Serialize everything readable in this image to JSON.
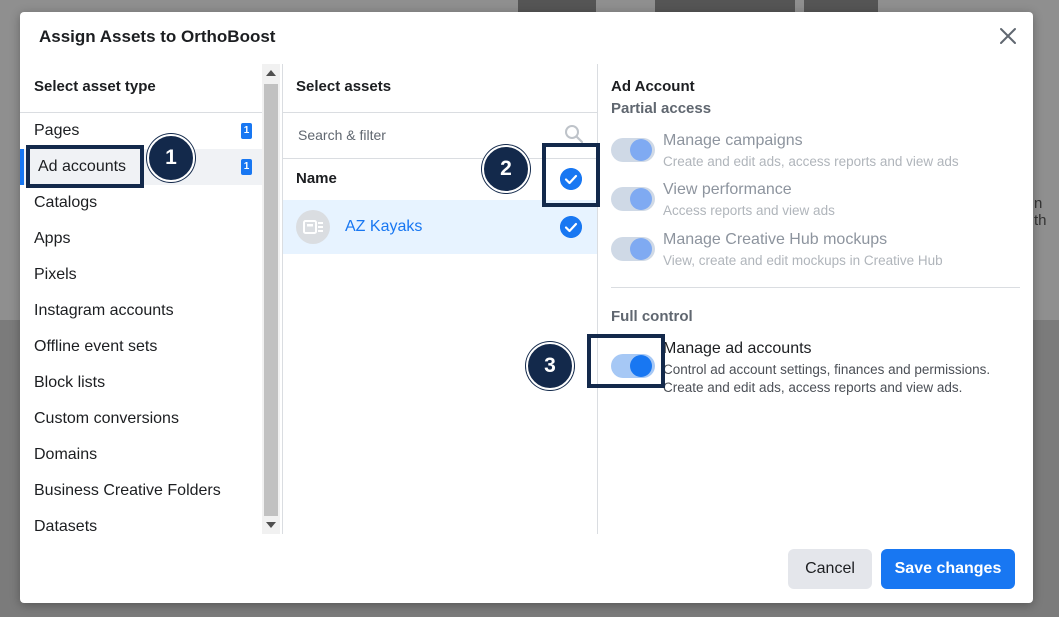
{
  "background": {
    "partial_text": "n th"
  },
  "modal": {
    "title": "Assign Assets to OrthoBoost",
    "close_icon": "close-icon"
  },
  "asset_types": {
    "heading": "Select asset type",
    "items": [
      {
        "label": "Pages",
        "count": "1"
      },
      {
        "label": "Ad accounts",
        "count": "1"
      },
      {
        "label": "Catalogs"
      },
      {
        "label": "Apps"
      },
      {
        "label": "Pixels"
      },
      {
        "label": "Instagram accounts"
      },
      {
        "label": "Offline event sets"
      },
      {
        "label": "Block lists"
      },
      {
        "label": "Custom conversions"
      },
      {
        "label": "Domains"
      },
      {
        "label": "Business Creative Folders"
      },
      {
        "label": "Datasets"
      }
    ],
    "selected_index": 1
  },
  "assets": {
    "heading": "Select assets",
    "search_placeholder": "Search & filter",
    "name_header": "Name",
    "rows": [
      {
        "name": "AZ Kayaks",
        "checked": true
      }
    ]
  },
  "permissions": {
    "heading": "Ad Account",
    "partial_heading": "Partial access",
    "partial_items": [
      {
        "title": "Manage campaigns",
        "description": "Create and edit ads, access reports and view ads"
      },
      {
        "title": "View performance",
        "description": "Access reports and view ads"
      },
      {
        "title": "Manage Creative Hub mockups",
        "description": "View, create and edit mockups in Creative Hub"
      }
    ],
    "full_heading": "Full control",
    "full_items": [
      {
        "title": "Manage ad accounts",
        "description_line1": "Control ad account settings, finances and permissions.",
        "description_line2": "Create and edit ads, access reports and view ads.",
        "enabled": true
      }
    ]
  },
  "footer": {
    "cancel_label": "Cancel",
    "save_label": "Save changes"
  },
  "annotations": {
    "step1": "1",
    "step2": "2",
    "step3": "3",
    "color": "#13294b"
  },
  "colors": {
    "accent": "#1877f2",
    "selected_row": "#e7f3ff"
  }
}
